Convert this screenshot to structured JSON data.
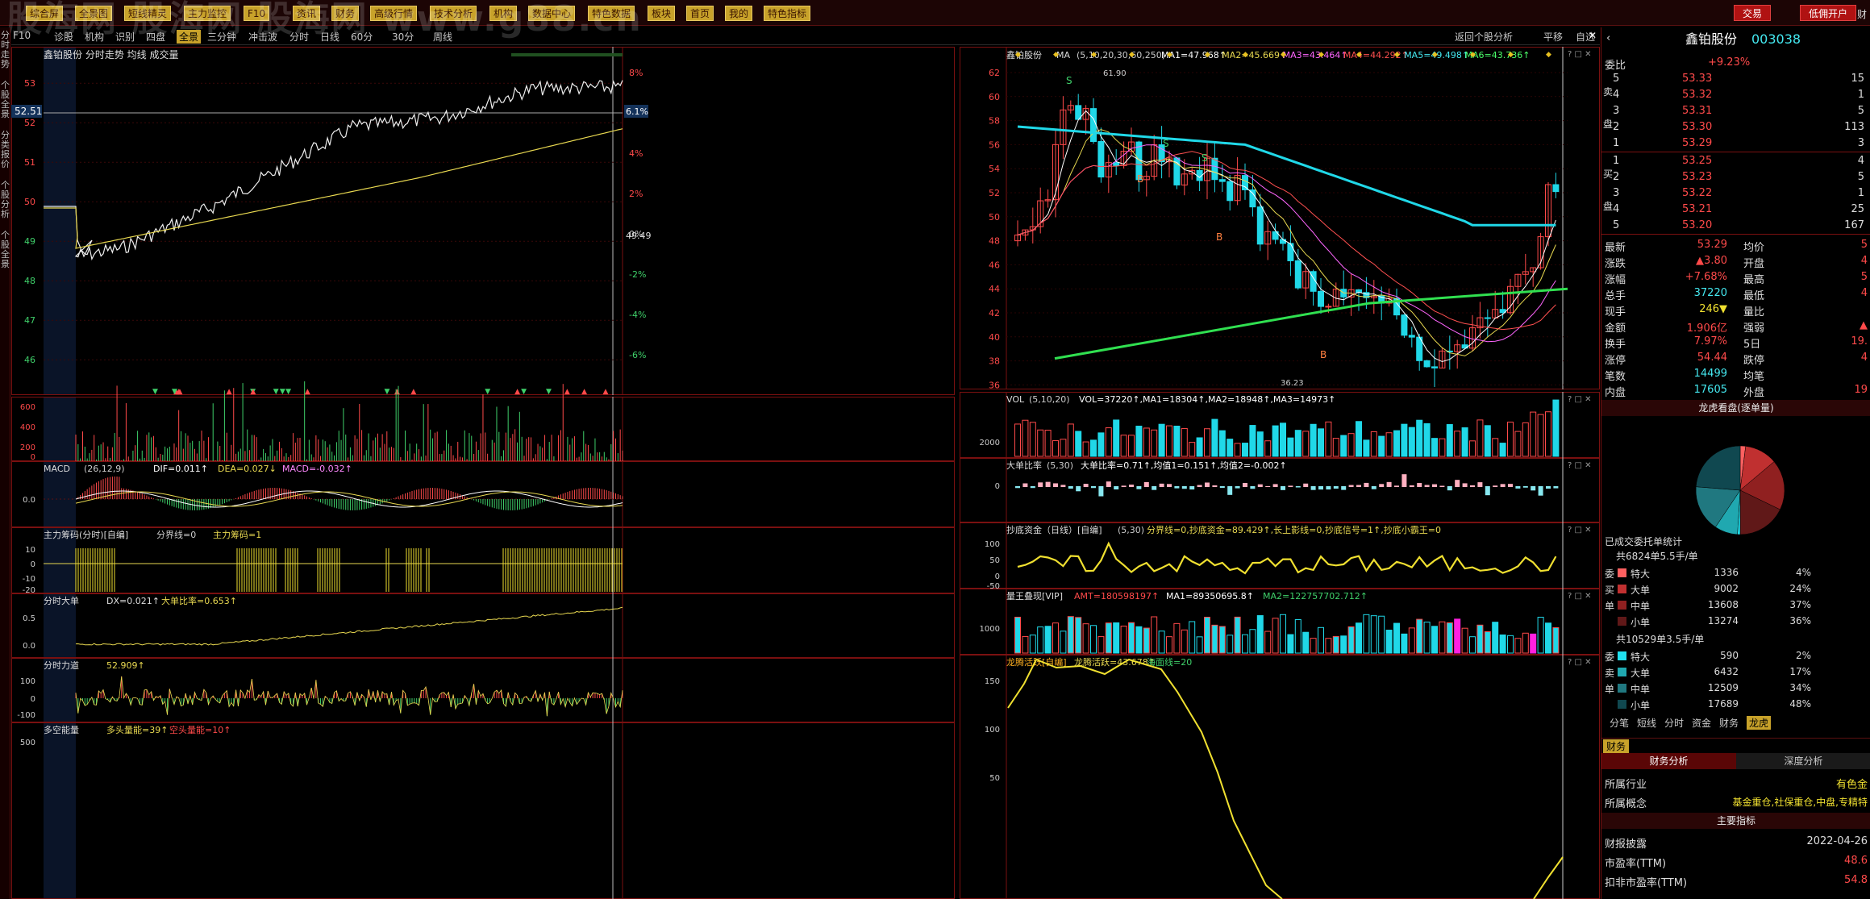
{
  "top_menu": [
    "综合屏",
    "全景图",
    "短线精灵",
    "主力监控",
    "F10",
    "资讯",
    "财务",
    "高级行情",
    "技术分析",
    "机构",
    "数据中心",
    "特色数据",
    "板块",
    "首页",
    "我的",
    "特色指标"
  ],
  "watermark": "股海网 股海网 股海网 www.g88.cn",
  "top_right": {
    "trade": "交易",
    "open_account": "低佣开户",
    "extra": "财"
  },
  "left_strip": [
    "分时走势",
    "个股全景",
    "分类报价",
    "个股分析",
    "个股全景"
  ],
  "toolbar": {
    "left": [
      "F10",
      "诊股",
      "机构",
      "识别",
      "四盘",
      "全景",
      "三分钟",
      "冲击波",
      "分时",
      "日线",
      "60分",
      "30分",
      "周线"
    ],
    "active": "全景",
    "right": [
      "返回个股分析",
      "平移",
      "自选"
    ]
  },
  "intraday": {
    "title": "鑫铂股份 分时走势 均线 成交量",
    "price_ticks": [
      "53",
      "52",
      "51",
      "50",
      "49",
      "48",
      "47",
      "46"
    ],
    "pct_ticks": [
      "8%",
      "6%",
      "4%",
      "2%",
      "0%",
      "-2%",
      "-4%",
      "-6%"
    ],
    "current_price": "52.51",
    "current_pct": "6.1%",
    "mid_value": "49.49"
  },
  "vol_panel": {
    "ticks": [
      "600",
      "400",
      "200",
      "0"
    ]
  },
  "macd_panel": {
    "title": "MACD",
    "params": "(26,12,9)",
    "dif": "DIF=0.011↑",
    "dea": "DEA=0.027↓",
    "macd": "MACD=-0.032↑",
    "tick": "0.0"
  },
  "zlcm_panel": {
    "title": "主力筹码(分时)[自编]",
    "params": "分界线=0",
    "value": "主力筹码=1",
    "ticks": [
      "10",
      "0",
      "-10",
      "-20"
    ]
  },
  "dx_panel": {
    "title": "分时大单",
    "dx": "DX=0.021↑",
    "ratio": "大单比率=0.653↑",
    "ticks": [
      "0.5",
      "0.0"
    ]
  },
  "force_panel": {
    "title": "分时力道",
    "value": "52.909↑",
    "ticks": [
      "100",
      "0",
      "-100"
    ]
  },
  "energy_panel": {
    "title": "多空能量",
    "value": "多头量能=39↑",
    "value2": "空头量能=10↑",
    "tick": "500"
  },
  "daily": {
    "title": "鑫铂股份",
    "ma_label": "MA",
    "params": "(5,10,20,30,60,250)",
    "ma": [
      "MA1=47.968↑",
      "MA2=45.669↑",
      "MA3=43.464↑",
      "MA4=44.292↑",
      "MA5=49.498↑",
      "MA6=43.736↑"
    ],
    "ticks": [
      "62",
      "60",
      "58",
      "56",
      "54",
      "52",
      "50",
      "48",
      "46",
      "44",
      "42",
      "40",
      "38",
      "36"
    ],
    "high_label": "61.90",
    "low_label": "36.23",
    "signals": [
      "S",
      "S",
      "S",
      "B",
      "B",
      "B"
    ]
  },
  "daily_vol": {
    "title": "VOL",
    "params": "(5,10,20)",
    "values": "VOL=37220↑,MA1=18304↑,MA2=18948↑,MA3=14973↑",
    "tick": "2000"
  },
  "big_ratio": {
    "title": "大单比率",
    "params": "(5,30)",
    "values": "大单比率=0.71↑,均值1=0.151↑,均值2=-0.002↑",
    "tick": "0"
  },
  "bottom_fund": {
    "title": "抄底资金（日线）[自编]",
    "params": "(5,30)",
    "values": "分界线=0,抄底资金=89.429↑,长上影线=0,抄底信号=1↑,抄底小霸王=0",
    "ticks": [
      "100",
      "50",
      "0",
      "-50"
    ]
  },
  "vol_emerge": {
    "title": "量王叠现[VIP]",
    "amt": "AMT=180598197↑",
    "ma1": "MA1=89350695.8↑",
    "ma2": "MA2=122757702.712↑",
    "tick": "1000"
  },
  "dragon": {
    "title": "龙腾活跃[自编]",
    "value": "龙腾活跃=43.678↑",
    "sea": "海面线=20",
    "ticks": [
      "150",
      "100",
      "50"
    ]
  },
  "side": {
    "name": "鑫铂股份",
    "code": "003038",
    "webi_label": "委比",
    "webi": "+9.23%",
    "asks": [
      [
        "5",
        "53.33",
        "15"
      ],
      [
        "4",
        "53.32",
        "1"
      ],
      [
        "3",
        "53.31",
        "5"
      ],
      [
        "2",
        "53.30",
        "113"
      ],
      [
        "1",
        "53.29",
        "3"
      ]
    ],
    "bids": [
      [
        "1",
        "53.25",
        "4"
      ],
      [
        "2",
        "53.23",
        "5"
      ],
      [
        "3",
        "53.22",
        "1"
      ],
      [
        "4",
        "53.21",
        "25"
      ],
      [
        "5",
        "53.20",
        "167"
      ]
    ],
    "sell_label": "卖盘",
    "buy_label": "买盘",
    "stats": [
      [
        "最新",
        "53.29",
        "均价",
        "5"
      ],
      [
        "涨跌",
        "▲3.80",
        "开盘",
        "4"
      ],
      [
        "涨幅",
        "+7.68%",
        "最高",
        "5"
      ],
      [
        "总手",
        "37220",
        "最低",
        "4"
      ],
      [
        "现手",
        "246▼",
        "量比",
        ""
      ],
      [
        "金额",
        "1.906亿",
        "强弱",
        "▲"
      ],
      [
        "换手",
        "7.97%",
        "5日",
        "19."
      ],
      [
        "涨停",
        "54.44",
        "跌停",
        "4"
      ],
      [
        "笔数",
        "14499",
        "均笔",
        ""
      ],
      [
        "内盘",
        "17605",
        "外盘",
        "19"
      ]
    ],
    "dragon_title": "龙虎看盘(逐单量)",
    "settled": "已成交委托单统计",
    "buy_summary": "共6824单5.5手/单",
    "buy_rows": [
      [
        "特大",
        "1336",
        "4%"
      ],
      [
        "大单",
        "9002",
        "24%"
      ],
      [
        "中单",
        "13608",
        "37%"
      ],
      [
        "小单",
        "13274",
        "36%"
      ]
    ],
    "buy_side": [
      "委",
      "买",
      "单"
    ],
    "sell_summary": "共10529单3.5手/单",
    "sell_rows": [
      [
        "特大",
        "590",
        "2%"
      ],
      [
        "大单",
        "6432",
        "17%"
      ],
      [
        "中单",
        "12509",
        "34%"
      ],
      [
        "小单",
        "17689",
        "48%"
      ]
    ],
    "sell_side": [
      "委",
      "卖",
      "单"
    ],
    "tabs": [
      "分笔",
      "短线",
      "分时",
      "资金",
      "财务",
      "龙虎"
    ],
    "fin_tab": "财务",
    "fin_title": "财务分析",
    "depth_title": "深度分析",
    "industry_label": "所属行业",
    "industry": "有色金",
    "concept_label": "所属概念",
    "concept": "基金重仓,社保重仓,中盘,专精特",
    "main_title": "主要指标",
    "report_label": "财报披露",
    "report": "2022-04-26",
    "pe_label": "市盈率(TTM)",
    "pe": "48.6",
    "pe2_label": "扣非市盈率(TTM)",
    "pe2": "54.8"
  },
  "colors": {
    "up": "#ff4a4a",
    "down": "#3fd06a",
    "ma_yellow": "#e8d850",
    "cyan": "#20d8e8",
    "frame": "#7a1010"
  }
}
